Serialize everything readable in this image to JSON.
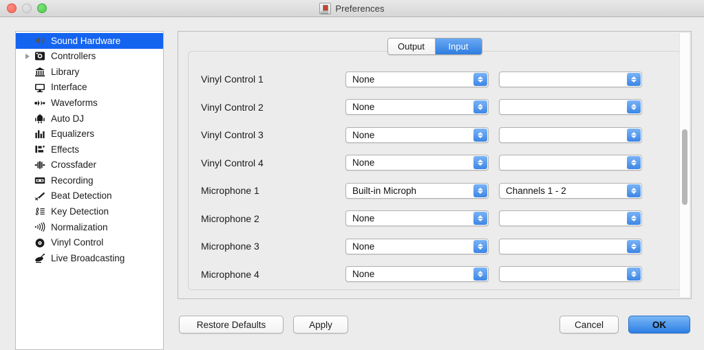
{
  "window": {
    "title": "Preferences",
    "title_icon": "mixer-icon",
    "traffic_lights": [
      "close",
      "minimize",
      "maximize"
    ]
  },
  "sidebar": {
    "items": [
      {
        "label": "Sound Hardware",
        "icon": "speaker-icon",
        "selected": true,
        "disclosure": false
      },
      {
        "label": "Controllers",
        "icon": "controller-icon",
        "selected": false,
        "disclosure": true
      },
      {
        "label": "Library",
        "icon": "library-icon",
        "selected": false,
        "disclosure": false
      },
      {
        "label": "Interface",
        "icon": "monitor-icon",
        "selected": false,
        "disclosure": false
      },
      {
        "label": "Waveforms",
        "icon": "waveform-icon",
        "selected": false,
        "disclosure": false
      },
      {
        "label": "Auto DJ",
        "icon": "robot-icon",
        "selected": false,
        "disclosure": false
      },
      {
        "label": "Equalizers",
        "icon": "equalizer-icon",
        "selected": false,
        "disclosure": false
      },
      {
        "label": "Effects",
        "icon": "effects-icon",
        "selected": false,
        "disclosure": false
      },
      {
        "label": "Crossfader",
        "icon": "crossfader-icon",
        "selected": false,
        "disclosure": false
      },
      {
        "label": "Recording",
        "icon": "cassette-icon",
        "selected": false,
        "disclosure": false
      },
      {
        "label": "Beat Detection",
        "icon": "drumstick-icon",
        "selected": false,
        "disclosure": false
      },
      {
        "label": "Key Detection",
        "icon": "treble-clef-icon",
        "selected": false,
        "disclosure": false
      },
      {
        "label": "Normalization",
        "icon": "signal-icon",
        "selected": false,
        "disclosure": false
      },
      {
        "label": "Vinyl Control",
        "icon": "vinyl-record-icon",
        "selected": false,
        "disclosure": false
      },
      {
        "label": "Live Broadcasting",
        "icon": "satellite-dish-icon",
        "selected": false,
        "disclosure": false
      }
    ]
  },
  "main": {
    "tabs": [
      {
        "label": "Output",
        "active": false
      },
      {
        "label": "Input",
        "active": true
      }
    ],
    "rows": [
      {
        "label": "Vinyl Control 1",
        "device": "None",
        "channels": ""
      },
      {
        "label": "Vinyl Control 2",
        "device": "None",
        "channels": ""
      },
      {
        "label": "Vinyl Control 3",
        "device": "None",
        "channels": ""
      },
      {
        "label": "Vinyl Control 4",
        "device": "None",
        "channels": ""
      },
      {
        "label": "Microphone 1",
        "device": "Built-in Microph",
        "channels": "Channels 1 - 2"
      },
      {
        "label": "Microphone 2",
        "device": "None",
        "channels": ""
      },
      {
        "label": "Microphone 3",
        "device": "None",
        "channels": ""
      },
      {
        "label": "Microphone 4",
        "device": "None",
        "channels": ""
      }
    ]
  },
  "buttons": {
    "restore_defaults": "Restore Defaults",
    "apply": "Apply",
    "cancel": "Cancel",
    "ok": "OK"
  },
  "colors": {
    "selection_blue": "#1464f0",
    "accent_blue": "#2d7fe4",
    "window_bg": "#ececec",
    "panel_bg": "#ececec",
    "sidebar_bg": "#ffffff"
  }
}
